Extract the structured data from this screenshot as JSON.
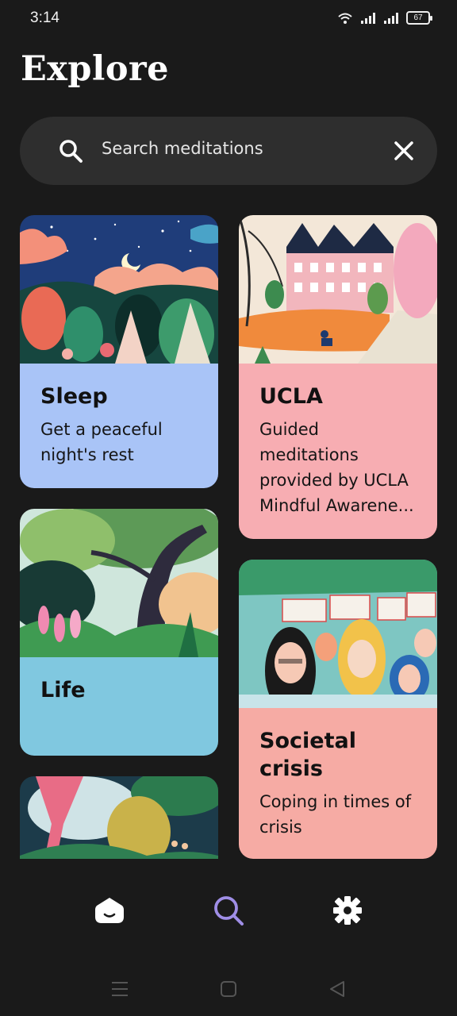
{
  "status_bar": {
    "time": "3:14",
    "battery": "67"
  },
  "header": {
    "title": "Explore"
  },
  "search": {
    "placeholder": "Search meditations"
  },
  "cards": [
    {
      "title": "Sleep",
      "subtitle": "Get a peaceful night's rest",
      "color": "#a9c4f7"
    },
    {
      "title": "UCLA",
      "subtitle": "Guided meditations provided by UCLA Mindful Awarene...",
      "color": "#f7adb2"
    },
    {
      "title": "Life",
      "subtitle": "",
      "color": "#80c8e0"
    },
    {
      "title": "Societal crisis",
      "subtitle": "Coping in times of crisis",
      "color": "#f6aba4"
    }
  ],
  "bottom_nav": {
    "items": [
      "home-icon",
      "search-icon",
      "settings-icon"
    ],
    "active": "search",
    "accent": "#9f8ee6"
  },
  "system_nav": [
    "menu-icon",
    "home-square-icon",
    "back-icon"
  ]
}
